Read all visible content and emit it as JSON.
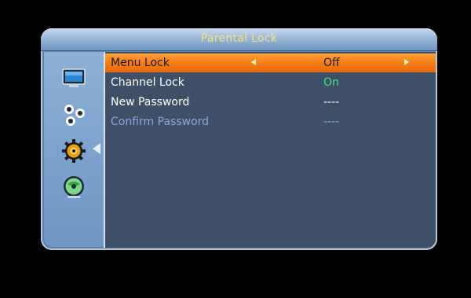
{
  "window": {
    "title": "Parental Lock"
  },
  "sidebar": {
    "items": [
      {
        "name": "tv-monitor-icon"
      },
      {
        "name": "satellite-dishes-icon"
      },
      {
        "name": "gear-icon",
        "active": true
      },
      {
        "name": "globe-icon"
      }
    ]
  },
  "menu": {
    "rows": [
      {
        "label": "Menu Lock",
        "value": "Off",
        "state": "selected"
      },
      {
        "label": "Channel Lock",
        "value": "On",
        "state": "on"
      },
      {
        "label": "New Password",
        "value": "----",
        "state": "normal"
      },
      {
        "label": "Confirm Password",
        "value": "----",
        "state": "disabled"
      }
    ]
  },
  "colors": {
    "title_text": "#f2e07a",
    "selected_row": "#f47a16",
    "on_value": "#4fe07a",
    "disabled_text": "#8aa8e0",
    "content_bg": "#3e5065",
    "panel_bg": "#5d7fa6"
  }
}
